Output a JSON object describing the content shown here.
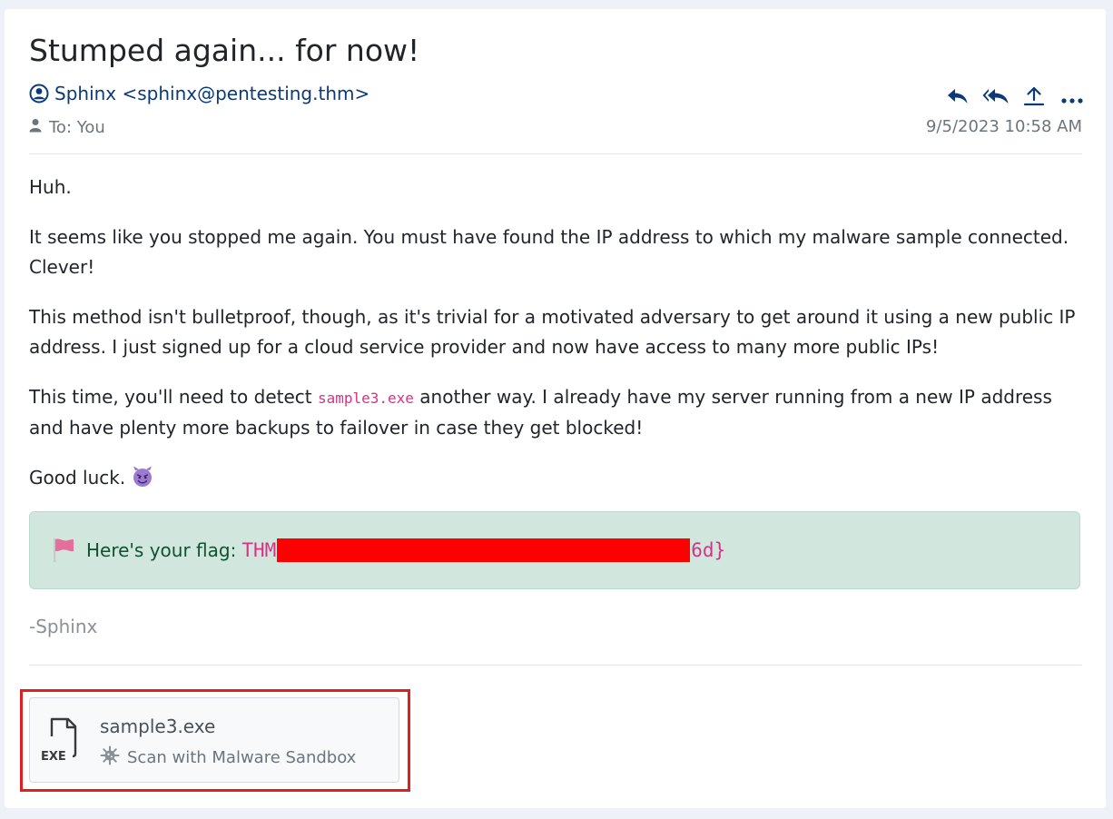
{
  "email": {
    "subject": "Stumped again... for now!",
    "sender": "Sphinx <sphinx@pentesting.thm>",
    "to": "To: You",
    "date": "9/5/2023 10:58 AM",
    "paragraphs": {
      "p1": "Huh.",
      "p2": "It seems like you stopped me again. You must have found the IP address to which my malware sample connected. Clever!",
      "p3": "This method isn't bulletproof, though, as it's trivial for a motivated adversary to get around it using a new public IP address. I just signed up for a cloud service provider and now have access to many more public IPs!",
      "p4_before": "This time, you'll need to detect ",
      "p4_code": "sample3.exe",
      "p4_after": " another way. I already have my server running from a new IP address and have plenty more backups to failover in case they get blocked!",
      "p5": "Good luck."
    },
    "flag": {
      "label": "Here's your flag:",
      "prefix": "THM",
      "suffix": "6d}"
    },
    "signature": "-Sphinx",
    "attachment": {
      "filename": "sample3.exe",
      "file_type": "EXE",
      "scan_label": "Scan with Malware Sandbox"
    }
  },
  "actions": [
    "reply-icon",
    "reply-all-icon",
    "forward-icon",
    "more-icon"
  ],
  "colors": {
    "accent": "#0b3a79",
    "flag_bg": "#d1e7dd",
    "code": "#d63384",
    "redaction": "#ff0000",
    "highlight": "#e01f1f"
  }
}
